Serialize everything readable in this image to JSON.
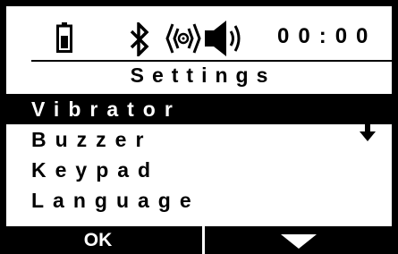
{
  "status_bar": {
    "time": "00:00",
    "icons": [
      "battery-icon",
      "bluetooth-icon",
      "vibrate-icon",
      "speaker-icon"
    ]
  },
  "title": "Settings",
  "menu": {
    "items": [
      {
        "label": "Vibrator",
        "selected": true
      },
      {
        "label": "Buzzer",
        "selected": false
      },
      {
        "label": "Keypad",
        "selected": false
      },
      {
        "label": "Language",
        "selected": false
      }
    ],
    "more_indicator": "down-arrow-icon"
  },
  "softkeys": {
    "left_label": "OK",
    "right_icon": "down-triangle-icon"
  },
  "colors": {
    "background": "#ffffff",
    "foreground": "#000000",
    "highlight": "#000000"
  }
}
